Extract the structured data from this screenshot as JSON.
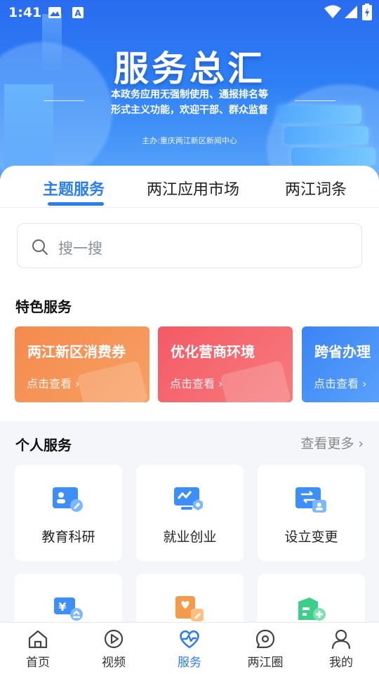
{
  "status_bar": {
    "time": "1:41",
    "icons": [
      "image-icon",
      "text-icon",
      "wifi-icon",
      "signal-icon",
      "battery-icon"
    ]
  },
  "banner": {
    "title": "服务总汇",
    "subtitle_line1": "本政务应用无强制使用、通报排名等",
    "subtitle_line2": "形式主义功能，欢迎干部、群众监督",
    "host": "主办:重庆两江新区新闻中心"
  },
  "tabs": [
    {
      "label": "主题服务",
      "active": true
    },
    {
      "label": "两江应用市场",
      "active": false
    },
    {
      "label": "两江词条",
      "active": false
    }
  ],
  "search": {
    "placeholder": "搜一搜"
  },
  "featured": {
    "title": "特色服务",
    "items": [
      {
        "title": "两江新区消费券",
        "link": "点击查看 ›",
        "color": "#f5894f"
      },
      {
        "title": "优化营商环境",
        "link": "点击查看 ›",
        "color": "#f4626b"
      },
      {
        "title": "跨省办理",
        "link": "点击查看 ›",
        "color": "#3a8df5"
      }
    ]
  },
  "personal": {
    "title": "个人服务",
    "more": "查看更多",
    "items": [
      {
        "label": "教育科研",
        "icon": "education-icon"
      },
      {
        "label": "就业创业",
        "icon": "employment-icon"
      },
      {
        "label": "设立变更",
        "icon": "registration-change-icon"
      },
      {
        "label": "",
        "icon": "finance-icon"
      },
      {
        "label": "",
        "icon": "health-certificate-icon"
      },
      {
        "label": "",
        "icon": "housing-add-icon"
      }
    ]
  },
  "bottom_nav": [
    {
      "label": "首页",
      "icon": "home-icon",
      "active": false
    },
    {
      "label": "视频",
      "icon": "play-icon",
      "active": false
    },
    {
      "label": "服务",
      "icon": "service-heart-icon",
      "active": true
    },
    {
      "label": "两江圈",
      "icon": "chat-circle-icon",
      "active": false
    },
    {
      "label": "我的",
      "icon": "profile-icon",
      "active": false
    }
  ],
  "colors": {
    "accent": "#2a7ef0",
    "banner_top": "#2a6cf0",
    "orange": "#f5894f",
    "red": "#f4626b",
    "blue": "#3a8df5"
  }
}
